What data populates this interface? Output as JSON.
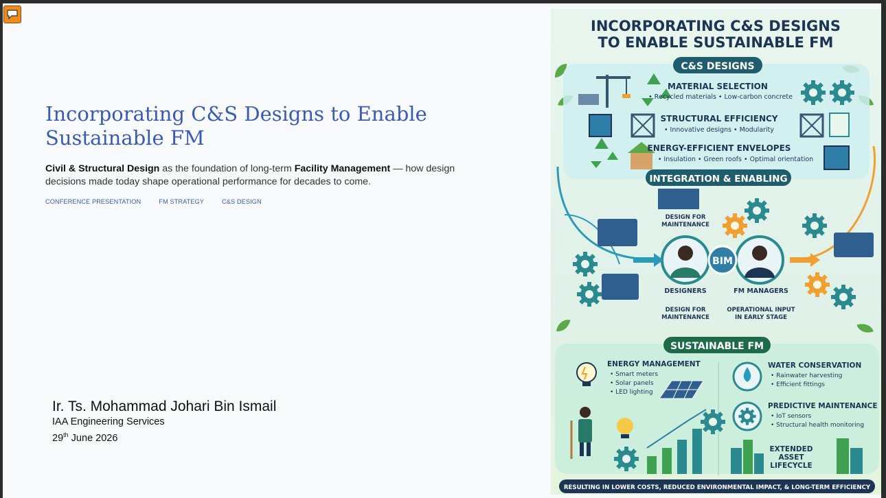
{
  "slide": {
    "title": "Incorporating C&S Designs to Enable Sustainable FM",
    "lead": {
      "bold1": "Civil & Structural Design",
      "text1": " as the foundation of long-term ",
      "bold2": "Facility Management",
      "text2": " — how design decisions made today shape operational performance for decades to come."
    },
    "tags": [
      "CONFERENCE PRESENTATION",
      "FM STRATEGY",
      "C&S DESIGN"
    ],
    "presenter": {
      "name": "Ir. Ts. Mohammad Johari Bin Ismail",
      "org": "IAA Engineering Services",
      "date_day": "29",
      "date_suffix": "th",
      "date_rest": " June 2026"
    }
  },
  "poster": {
    "title_line1": "INCORPORATING C&S DESIGNS",
    "title_line2": "TO ENABLE SUSTAINABLE FM",
    "section1": "C&S DESIGNS",
    "material_title": "MATERIAL SELECTION",
    "material_items": "• Recycled materials  • Low-carbon concrete",
    "structural_title": "STRUCTURAL EFFICIENCY",
    "structural_items": "• Innovative designs  • Modularity",
    "envelope_title": "ENERGY-EFFICIENT ENVELOPES",
    "envelope_items": "• Insulation  • Green roofs  • Optimal orientation",
    "section2": "INTEGRATION & ENABLING",
    "dfm_top1": "DESIGN FOR",
    "dfm_top2": "MAINTENANCE",
    "bim": "BIM",
    "designers": "DESIGNERS",
    "fm_managers": "FM MANAGERS",
    "dfm_bottom1": "DESIGN FOR",
    "dfm_bottom2": "MAINTENANCE",
    "opinput1": "OPERATIONAL INPUT",
    "opinput2": "IN EARLY STAGE",
    "section3": "SUSTAINABLE FM",
    "energy_title": "ENERGY MANAGEMENT",
    "energy_items": [
      "• Smart meters",
      "• Solar panels",
      "• LED lighting"
    ],
    "water_title": "WATER CONSERVATION",
    "water_items": [
      "• Rainwater harvesting",
      "• Efficient fittings"
    ],
    "predictive_title": "PREDICTIVE MAINTENANCE",
    "predictive_items": [
      "• IoT sensors",
      "• Structural health monitoring"
    ],
    "lifecycle_lines": [
      "EXTENDED",
      "ASSET",
      "LIFECYCLE"
    ],
    "footer": "RESULTING IN LOWER COSTS, REDUCED ENVIRONMENTAL IMPACT, & LONG-TERM EFFICIENCY"
  },
  "colors": {
    "title_blue": "#3a5bb5",
    "poster_navy": "#1c3554",
    "poster_teal": "#1f5d6e",
    "poster_green": "#1e6b4a",
    "gear": "#2a8a90",
    "orange": "#f0a030"
  },
  "icons": [
    "speech-bubble-icon",
    "gear-icon",
    "recycle-icon",
    "lightbulb-icon",
    "water-drop-icon",
    "solar-panel-icon"
  ]
}
